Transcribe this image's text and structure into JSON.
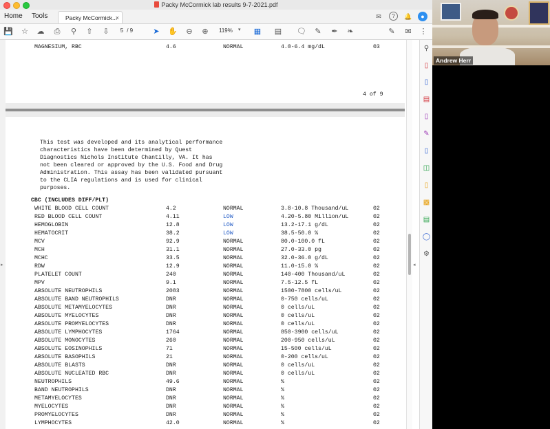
{
  "window": {
    "title": "Packy McCormick lab results 9-7-2021.pdf"
  },
  "tabs": {
    "home": "Home",
    "tools": "Tools",
    "document": "Packy McCormick...",
    "close": "×"
  },
  "toolbar": {
    "page_current": "5",
    "page_total": "/ 9",
    "zoom": "119%"
  },
  "video": {
    "participant_name": "Andrew Herr"
  },
  "document": {
    "top_rows": [
      {
        "test": "MAGNESIUM, RBC",
        "result": "4.6",
        "flag": "NORMAL",
        "range": "4.0-6.4 mg/dL",
        "lab": "03"
      }
    ],
    "page_footer": "4 of 9",
    "disclaimer": [
      "This test was developed and its analytical performance",
      "characteristics have been determined by Quest",
      "Diagnostics Nichols Institute Chantilly, VA. It has",
      "not been cleared or approved by the U.S. Food and Drug",
      "Administration. This assay has been validated pursuant",
      "to the CLIA regulations and is used for clinical",
      "purposes."
    ],
    "section_title": "CBC (INCLUDES DIFF/PLT)",
    "rows": [
      {
        "test": "WHITE BLOOD CELL COUNT",
        "result": "4.2",
        "flag": "NORMAL",
        "range": "3.8-10.8 Thousand/uL",
        "lab": "02"
      },
      {
        "test": "RED BLOOD CELL COUNT",
        "result": "4.11",
        "flag": "LOW",
        "range": "4.20-5.80 Million/uL",
        "lab": "02"
      },
      {
        "test": "HEMOGLOBIN",
        "result": "12.8",
        "flag": "LOW",
        "range": "13.2-17.1 g/dL",
        "lab": "02"
      },
      {
        "test": "HEMATOCRIT",
        "result": "38.2",
        "flag": "LOW",
        "range": "38.5-50.0 %",
        "lab": "02"
      },
      {
        "test": "MCV",
        "result": "92.9",
        "flag": "NORMAL",
        "range": "80.0-100.0 fL",
        "lab": "02"
      },
      {
        "test": "MCH",
        "result": "31.1",
        "flag": "NORMAL",
        "range": "27.0-33.0 pg",
        "lab": "02"
      },
      {
        "test": "MCHC",
        "result": "33.5",
        "flag": "NORMAL",
        "range": "32.0-36.0 g/dL",
        "lab": "02"
      },
      {
        "test": "RDW",
        "result": "12.9",
        "flag": "NORMAL",
        "range": "11.0-15.0 %",
        "lab": "02"
      },
      {
        "test": "PLATELET COUNT",
        "result": "240",
        "flag": "NORMAL",
        "range": "140-400 Thousand/uL",
        "lab": "02"
      },
      {
        "test": "MPV",
        "result": "9.1",
        "flag": "NORMAL",
        "range": "7.5-12.5 fL",
        "lab": "02"
      },
      {
        "test": "ABSOLUTE NEUTROPHILS",
        "result": "2083",
        "flag": "NORMAL",
        "range": "1500-7800 cells/uL",
        "lab": "02"
      },
      {
        "test": "ABSOLUTE BAND NEUTROPHILS",
        "result": "DNR",
        "flag": "NORMAL",
        "range": "0-750 cells/uL",
        "lab": "02"
      },
      {
        "test": "ABSOLUTE METAMYELOCYTES",
        "result": "DNR",
        "flag": "NORMAL",
        "range": "0 cells/uL",
        "lab": "02"
      },
      {
        "test": "ABSOLUTE MYELOCYTES",
        "result": "DNR",
        "flag": "NORMAL",
        "range": "0 cells/uL",
        "lab": "02"
      },
      {
        "test": "ABSOLUTE PROMYELOCYTES",
        "result": "DNR",
        "flag": "NORMAL",
        "range": "0 cells/uL",
        "lab": "02"
      },
      {
        "test": "ABSOLUTE LYMPHOCYTES",
        "result": "1764",
        "flag": "NORMAL",
        "range": "850-3900 cells/uL",
        "lab": "02"
      },
      {
        "test": "ABSOLUTE MONOCYTES",
        "result": "260",
        "flag": "NORMAL",
        "range": "200-950 cells/uL",
        "lab": "02"
      },
      {
        "test": "ABSOLUTE EOSINOPHILS",
        "result": "71",
        "flag": "NORMAL",
        "range": "15-500 cells/uL",
        "lab": "02"
      },
      {
        "test": "ABSOLUTE BASOPHILS",
        "result": "21",
        "flag": "NORMAL",
        "range": "0-200 cells/uL",
        "lab": "02"
      },
      {
        "test": "ABSOLUTE BLASTS",
        "result": "DNR",
        "flag": "NORMAL",
        "range": "0 cells/uL",
        "lab": "02"
      },
      {
        "test": "ABSOLUTE NUCLEATED RBC",
        "result": "DNR",
        "flag": "NORMAL",
        "range": "0 cells/uL",
        "lab": "02"
      },
      {
        "test": "NEUTROPHILS",
        "result": "49.6",
        "flag": "NORMAL",
        "range": "%",
        "lab": "02"
      },
      {
        "test": "BAND NEUTROPHILS",
        "result": "DNR",
        "flag": "NORMAL",
        "range": "%",
        "lab": "02"
      },
      {
        "test": "METAMYELOCYTES",
        "result": "DNR",
        "flag": "NORMAL",
        "range": "%",
        "lab": "02"
      },
      {
        "test": "MYELOCYTES",
        "result": "DNR",
        "flag": "NORMAL",
        "range": "%",
        "lab": "02"
      },
      {
        "test": "PROMYELOCYTES",
        "result": "DNR",
        "flag": "NORMAL",
        "range": "%",
        "lab": "02"
      },
      {
        "test": "LYMPHOCYTES",
        "result": "42.0",
        "flag": "NORMAL",
        "range": "%",
        "lab": "02"
      }
    ]
  },
  "colors": {
    "low_flag": "#1a55c4",
    "accent": "#1667d6"
  },
  "icons": {
    "toolbar": [
      "save-icon",
      "bookmark-icon",
      "upload-icon",
      "print-icon",
      "search-icon",
      "page-up-icon",
      "page-down-icon",
      "cursor-icon",
      "hand-icon",
      "zoom-out-icon",
      "zoom-in-icon",
      "view-icon",
      "scan-icon",
      "comment-icon",
      "highlight-icon",
      "draw-icon",
      "sign-icon",
      "fill-sign-icon",
      "email-icon",
      "more-icon"
    ],
    "rail": [
      "search-icon",
      "export-pdf-icon",
      "create-pdf-icon",
      "edit-pdf-icon",
      "organize-icon",
      "fill-sign-icon",
      "send-icon",
      "compress-icon",
      "request-signature-icon",
      "comment-icon",
      "compare-icon",
      "protect-icon",
      "more-tools-icon"
    ]
  }
}
